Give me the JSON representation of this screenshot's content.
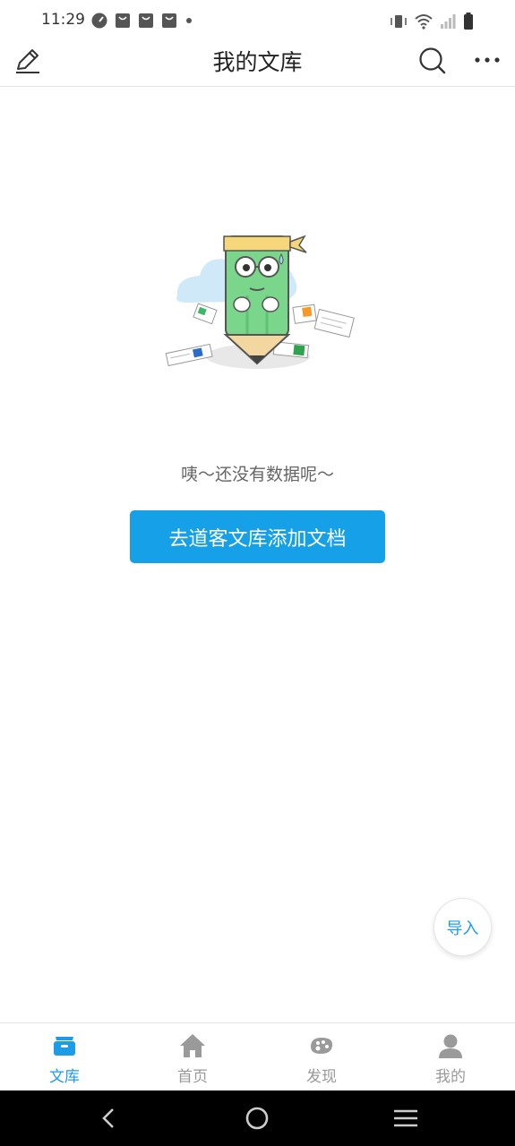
{
  "status_bar": {
    "time": "11:29"
  },
  "header": {
    "title": "我的文库",
    "edit_icon": "pencil-icon",
    "search_icon": "search-icon",
    "more_icon": "more-icon"
  },
  "empty_state": {
    "message": "咦～还没有数据呢～",
    "button_label": "去道客文库添加文档"
  },
  "fab": {
    "label": "导入"
  },
  "tabs": [
    {
      "label": "文库",
      "icon": "library-icon",
      "active": true
    },
    {
      "label": "首页",
      "icon": "home-icon",
      "active": false
    },
    {
      "label": "发现",
      "icon": "discover-icon",
      "active": false
    },
    {
      "label": "我的",
      "icon": "profile-icon",
      "active": false
    }
  ],
  "colors": {
    "accent": "#1c9ce6",
    "button": "#15a0e8",
    "inactive": "#999999"
  }
}
